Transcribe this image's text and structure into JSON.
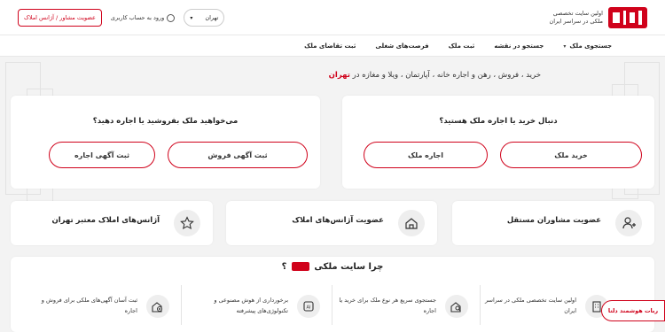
{
  "header": {
    "tagline_line1": "اولین سایت تخصصی",
    "tagline_line2": "ملکی در سراسر ایران",
    "agency_button": "عضویت مشاور / آژانس املاک",
    "login_link": "ورود به حساب کاربری",
    "city": "تهران"
  },
  "nav": {
    "items": [
      {
        "label": "جستجوی ملک"
      },
      {
        "label": "جستجو در نقشه"
      },
      {
        "label": "ثبت ملک"
      },
      {
        "label": "فرصت‌های شغلی"
      },
      {
        "label": "ثبت تقاضای ملک"
      }
    ]
  },
  "hero": {
    "title_main": "خرید ، فروش ، رهن و اجاره خانه ، آپارتمان ، ویلا و مغازه در",
    "title_city": "تهران"
  },
  "buy_card": {
    "title": "دنبال خرید یا اجاره ملک هستید؟",
    "buy_button": "خرید ملک",
    "rent_button": "اجاره ملک"
  },
  "sell_card": {
    "title": "می‌خواهید ملک بفروشید یا اجاره دهید؟",
    "sale_ad_button": "ثبت آگهی فروش",
    "rent_ad_button": "ثبت آگهی اجاره"
  },
  "features": [
    {
      "label": "عضویت مشاوران مستقل",
      "icon": "user-add-icon"
    },
    {
      "label": "عضویت آژانس‌های املاک",
      "icon": "house-icon"
    },
    {
      "label": "آژانس‌های املاک معتبر تهران",
      "icon": "star-icon"
    }
  ],
  "why": {
    "title_prefix": "چرا سایت ملکی",
    "title_suffix": "؟",
    "items": [
      {
        "text": "اولین سایت تخصصی ملکی در سراسر ایران",
        "icon": "building-icon"
      },
      {
        "text": "جستجوی سریع هر نوع ملک برای خرید یا اجاره",
        "icon": "search-house-icon"
      },
      {
        "text": "برخورداری از هوش مصنوعی و تکنولوژی‌های پیشرفته",
        "icon": "ai-icon"
      },
      {
        "text": "ثبت آسان آگهی‌های ملکی برای فروش و اجاره",
        "icon": "add-house-icon"
      }
    ]
  },
  "floating": {
    "label": "ربات هوشمند دلتا"
  },
  "colors": {
    "brand": "#d0021b",
    "background": "#f3f3f3"
  }
}
